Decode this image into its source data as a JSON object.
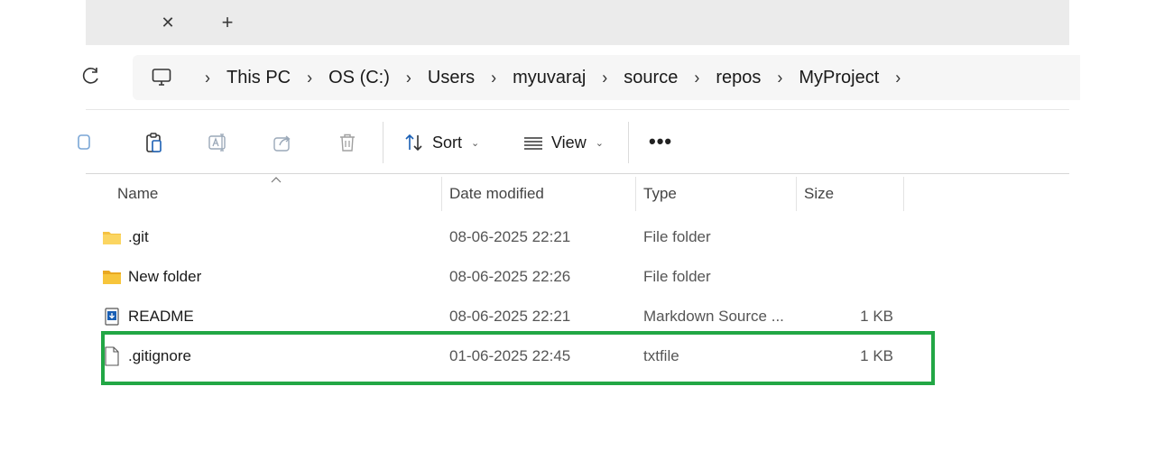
{
  "tabs": {
    "close_glyph": "✕",
    "new_glyph": "+"
  },
  "breadcrumb": {
    "separator": "›",
    "items": [
      "This PC",
      "OS (C:)",
      "Users",
      "myuvaraj",
      "source",
      "repos",
      "MyProject"
    ]
  },
  "toolbar": {
    "sort_label": "Sort",
    "view_label": "View",
    "more_label": "•••",
    "caret": "⌄"
  },
  "columns": {
    "name": "Name",
    "date_modified": "Date modified",
    "type": "Type",
    "size": "Size"
  },
  "files": [
    {
      "name": ".git",
      "date": "08-06-2025 22:21",
      "type": "File folder",
      "size": "",
      "icon": "folder-icon"
    },
    {
      "name": "New folder",
      "date": "08-06-2025 22:26",
      "type": "File folder",
      "size": "",
      "icon": "folder-icon"
    },
    {
      "name": "README",
      "date": "08-06-2025 22:21",
      "type": "Markdown Source ...",
      "size": "1 KB",
      "icon": "markdown-file-icon"
    },
    {
      "name": ".gitignore",
      "date": "01-06-2025 22:45",
      "type": "txtfile",
      "size": "1 KB",
      "icon": "text-file-icon"
    }
  ],
  "colors": {
    "highlight": "#22a745",
    "folder": "#f5c242",
    "accent": "#1a5fb4"
  }
}
